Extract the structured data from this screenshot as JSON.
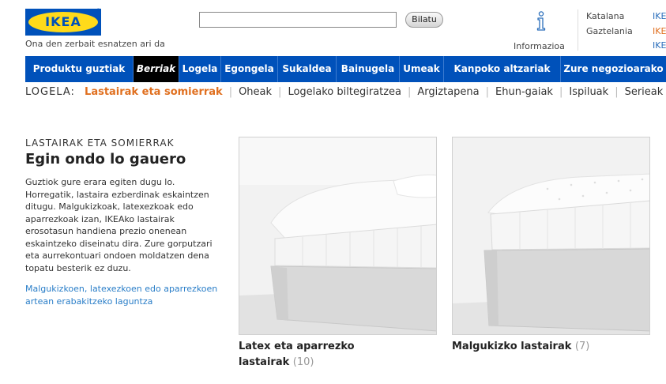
{
  "brand": {
    "logo_text": "IKEA",
    "registered": "®",
    "tagline": "Ona den zerbait esnatzen ari da"
  },
  "search": {
    "button_label": "Bilatu",
    "value": ""
  },
  "info": {
    "label": "Informazioa"
  },
  "languages": [
    {
      "name": "Katalana",
      "link": "IKE"
    },
    {
      "name": "Gaztelania",
      "link": "IKE"
    },
    {
      "link": "IKE"
    }
  ],
  "nav": {
    "items": [
      {
        "label": "Produktu guztiak"
      },
      {
        "label": "Berriak",
        "active": true
      },
      {
        "label": "Logela"
      },
      {
        "label": "Egongela"
      },
      {
        "label": "Sukaldea"
      },
      {
        "label": "Bainugela"
      },
      {
        "label": "Umeak"
      },
      {
        "label": "Kanpoko altzariak"
      },
      {
        "label": "Zure negozioarako"
      }
    ]
  },
  "subnav": {
    "label": "LOGELA:",
    "items": [
      "Lastairak eta somierrak",
      "Oheak",
      "Logelako biltegiratzea",
      "Argiztapena",
      "Ehun-gaiak",
      "Ispiluak",
      "Serieak"
    ]
  },
  "section": {
    "label": "LASTAIRAK ETA SOMIERRAK",
    "heading": "Egin ondo lo gauero",
    "body": "Guztiok gure erara egiten dugu lo. Horregatik, lastaira ezberdinak eskaintzen ditugu. Malgukizkoak, latexezkoak edo aparrezkoak izan, IKEAko lastairak erosotasun handiena prezio onenean eskaintzeko diseinatu dira. Zure gorputzari eta aurrekontuari ondoen moldatzen dena topatu besterik ez duzu.",
    "link": "Malgukizkoen, latexezkoen edo aparrezkoen artean erabakitzeko laguntza"
  },
  "products": [
    {
      "title_line1": "Latex eta aparrezko",
      "title_line2": "lastairak",
      "count": "(10)"
    },
    {
      "title_line1": "Malgukizko lastairak",
      "count": "(7)"
    }
  ],
  "colors": {
    "nav_bg": "#0051ba",
    "accent": "#e07020",
    "link": "#2a7ec8",
    "logo_yellow": "#ffda1a"
  }
}
